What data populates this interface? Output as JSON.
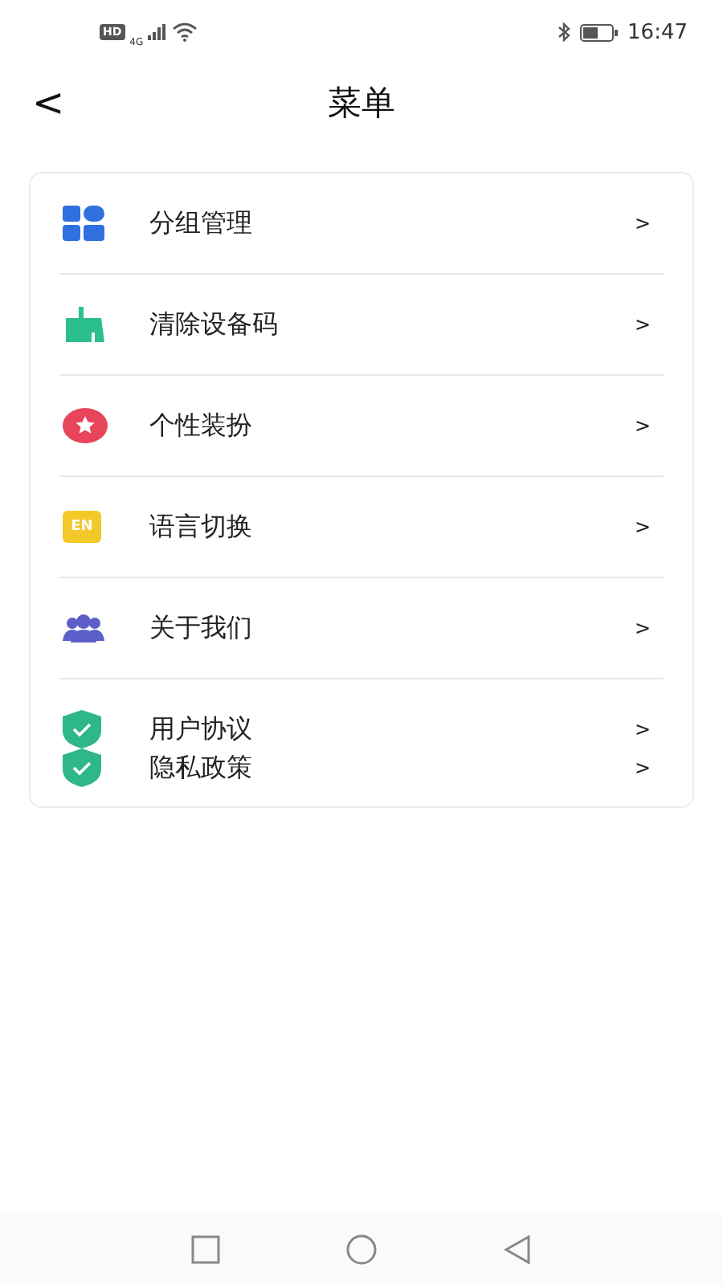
{
  "status_bar": {
    "time": "16:47",
    "left_badge": "HD",
    "network": "4G"
  },
  "header": {
    "title": "菜单",
    "back": "<"
  },
  "menu": [
    {
      "kind": "single",
      "entries": [
        {
          "kind": "grid",
          "label": "分组管理",
          "chevron": ">"
        }
      ]
    },
    {
      "kind": "single",
      "entries": [
        {
          "kind": "broom",
          "label": "清除设备码",
          "chevron": ">"
        }
      ]
    },
    {
      "kind": "single",
      "entries": [
        {
          "kind": "star",
          "label": "个性装扮",
          "chevron": ">"
        }
      ]
    },
    {
      "kind": "single",
      "entries": [
        {
          "kind": "lang",
          "icon_text": "EN",
          "label": "语言切换",
          "chevron": ">"
        }
      ]
    },
    {
      "kind": "single",
      "entries": [
        {
          "kind": "people",
          "label": "关于我们",
          "chevron": ">"
        }
      ]
    },
    {
      "kind": "double",
      "entries": [
        {
          "kind": "shield",
          "label": "用户协议",
          "chevron": ">"
        },
        {
          "kind": "shield",
          "label": "隐私政策",
          "chevron": ">"
        }
      ]
    }
  ]
}
